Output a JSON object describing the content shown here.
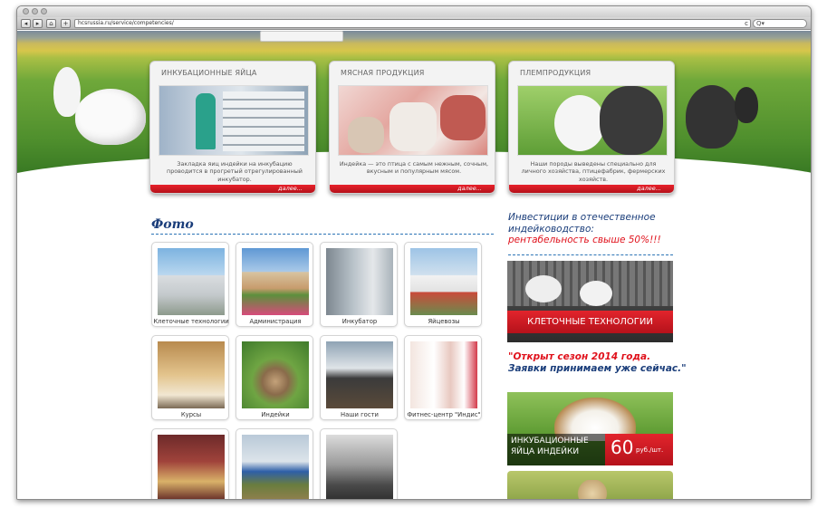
{
  "browser": {
    "url": "hcsrussia.ru/service/competencies/",
    "reload_icon": "reload-icon",
    "search_icon": "search-icon",
    "search_placeholder": "Q▾"
  },
  "cards": [
    {
      "title": "ИНКУБАЦИОННЫЕ ЯЙЦА",
      "text": "Закладка яиц индейки на инкубацию проводится в прогретый отрегулированный инкубатор.",
      "more": "далее..."
    },
    {
      "title": "МЯСНАЯ ПРОДУКЦИЯ",
      "text": "Индейка — это птица с самым нежным, сочным, вкусным и популярным мясом.",
      "more": "далее..."
    },
    {
      "title": "ПЛЕМПРОДУКЦИЯ",
      "text": "Наши породы выведены специально для личного хозяйства, птицефабрик, фермерских хозяйств.",
      "more": "далее..."
    }
  ],
  "photo_section": {
    "title": "Фото"
  },
  "gallery": [
    {
      "caption": "Клеточные технологии"
    },
    {
      "caption": "Администрация"
    },
    {
      "caption": "Инкубатор"
    },
    {
      "caption": "Яйцевозы"
    },
    {
      "caption": "Курсы"
    },
    {
      "caption": "Индейки"
    },
    {
      "caption": "Наши гости"
    },
    {
      "caption": "Фитнес-центр \"Индис\""
    },
    {
      "caption": ""
    },
    {
      "caption": ""
    },
    {
      "caption": ""
    }
  ],
  "sidebar": {
    "invest_line1": "Инвестиции в отечественное",
    "invest_line2": "индейководство:",
    "invest_line3": "рентабельность свыше 50%!!!",
    "banner1_label": "КЛЕТОЧНЫЕ ТЕХНОЛОГИИ",
    "season_line1": "\"Открыт сезон 2014 года.",
    "season_line2": "Заявки принимаем уже сейчас.\"",
    "banner2_line1": "ИНКУБАЦИОННЫЕ",
    "banner2_line2": "ЯЙЦА ИНДЕЙКИ",
    "banner2_price": "60",
    "banner2_unit": "руб./шт."
  },
  "colors": {
    "accent_red": "#e0121c",
    "heading_blue": "#1a3d7a",
    "dash_blue": "#2c74b6"
  }
}
